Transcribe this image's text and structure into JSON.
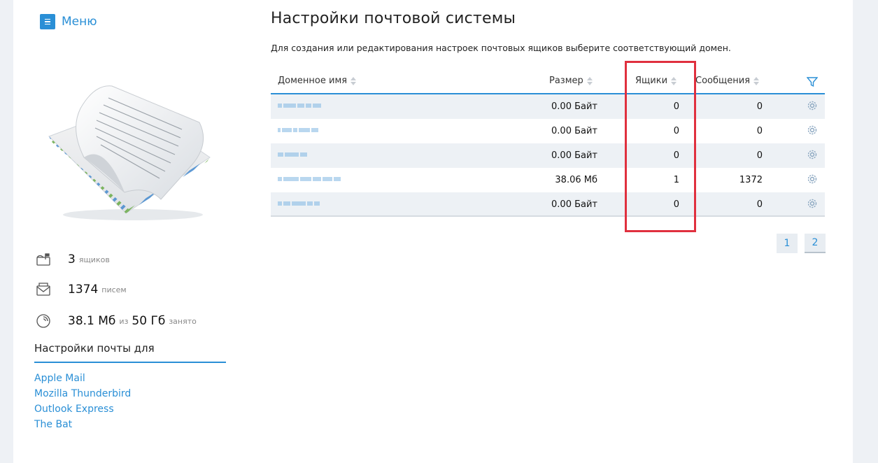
{
  "sidebar": {
    "menu_label": "Меню",
    "stats": {
      "mailboxes": {
        "value": "3",
        "unit": "ящиков"
      },
      "messages": {
        "value": "1374",
        "unit": "писем"
      },
      "storage": {
        "used": "38.1 Мб",
        "of": "из",
        "total": "50 Гб",
        "suffix": "занято"
      }
    },
    "mail_settings_heading": "Настройки почты для",
    "clients": [
      "Apple Mail",
      "Mozilla Thunderbird",
      "Outlook Express",
      "The Bat"
    ]
  },
  "main": {
    "title": "Настройки почтовой системы",
    "description": "Для создания или редактирования настроек почтовых ящиков выберите соответствующий домен.",
    "table": {
      "headers": {
        "domain": "Доменное имя",
        "size": "Размер",
        "mailboxes": "Ящики",
        "messages": "Сообщения"
      },
      "rows": [
        {
          "size": "0.00 Байт",
          "mailboxes": "0",
          "messages": "0"
        },
        {
          "size": "0.00 Байт",
          "mailboxes": "0",
          "messages": "0"
        },
        {
          "size": "0.00 Байт",
          "mailboxes": "0",
          "messages": "0"
        },
        {
          "size": "38.06 Мб",
          "mailboxes": "1",
          "messages": "1372"
        },
        {
          "size": "0.00 Байт",
          "mailboxes": "0",
          "messages": "0"
        }
      ]
    },
    "pagination": {
      "pages": [
        "1",
        "2"
      ],
      "current": "2"
    }
  },
  "colors": {
    "accent": "#2a8fd6",
    "highlight": "#e0303e",
    "stripe": "#edf1f5"
  },
  "icons": {
    "menu": "hamburger-icon",
    "mailbox": "mailbox-icon",
    "envelope": "envelope-icon",
    "storage": "disk-icon",
    "filter": "filter-icon",
    "gear": "gear-icon"
  }
}
